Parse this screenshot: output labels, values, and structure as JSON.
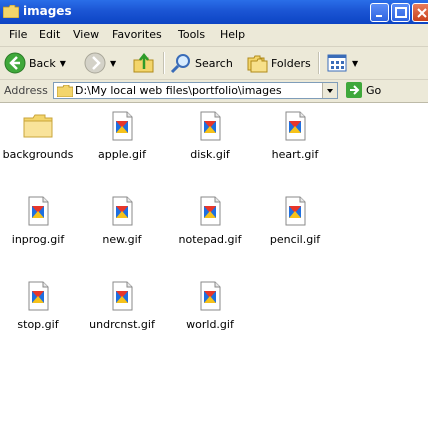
{
  "window": {
    "title": "images"
  },
  "menu": [
    "File",
    "Edit",
    "View",
    "Favorites",
    "Tools",
    "Help"
  ],
  "toolbar": {
    "back_label": "Back",
    "search_label": "Search",
    "folders_label": "Folders"
  },
  "address": {
    "label": "Address",
    "value": "D:\\My local web files\\portfolio\\images",
    "go_label": "Go"
  },
  "files": [
    {
      "name": "backgrounds",
      "type": "folder-icon"
    },
    {
      "name": "apple.gif",
      "type": "gif-file-icon"
    },
    {
      "name": "disk.gif",
      "type": "gif-file-icon"
    },
    {
      "name": "heart.gif",
      "type": "gif-file-icon"
    },
    {
      "name": "inprog.gif",
      "type": "gif-file-icon"
    },
    {
      "name": "new.gif",
      "type": "gif-file-icon"
    },
    {
      "name": "notepad.gif",
      "type": "gif-file-icon"
    },
    {
      "name": "pencil.gif",
      "type": "gif-file-icon"
    },
    {
      "name": "stop.gif",
      "type": "gif-file-icon"
    },
    {
      "name": "undrcnst.gif",
      "type": "gif-file-icon"
    },
    {
      "name": "world.gif",
      "type": "gif-file-icon"
    }
  ],
  "colors": {
    "titlebar": "#0c44c4",
    "chrome": "#ece9d8",
    "folder": "#f7d965"
  }
}
